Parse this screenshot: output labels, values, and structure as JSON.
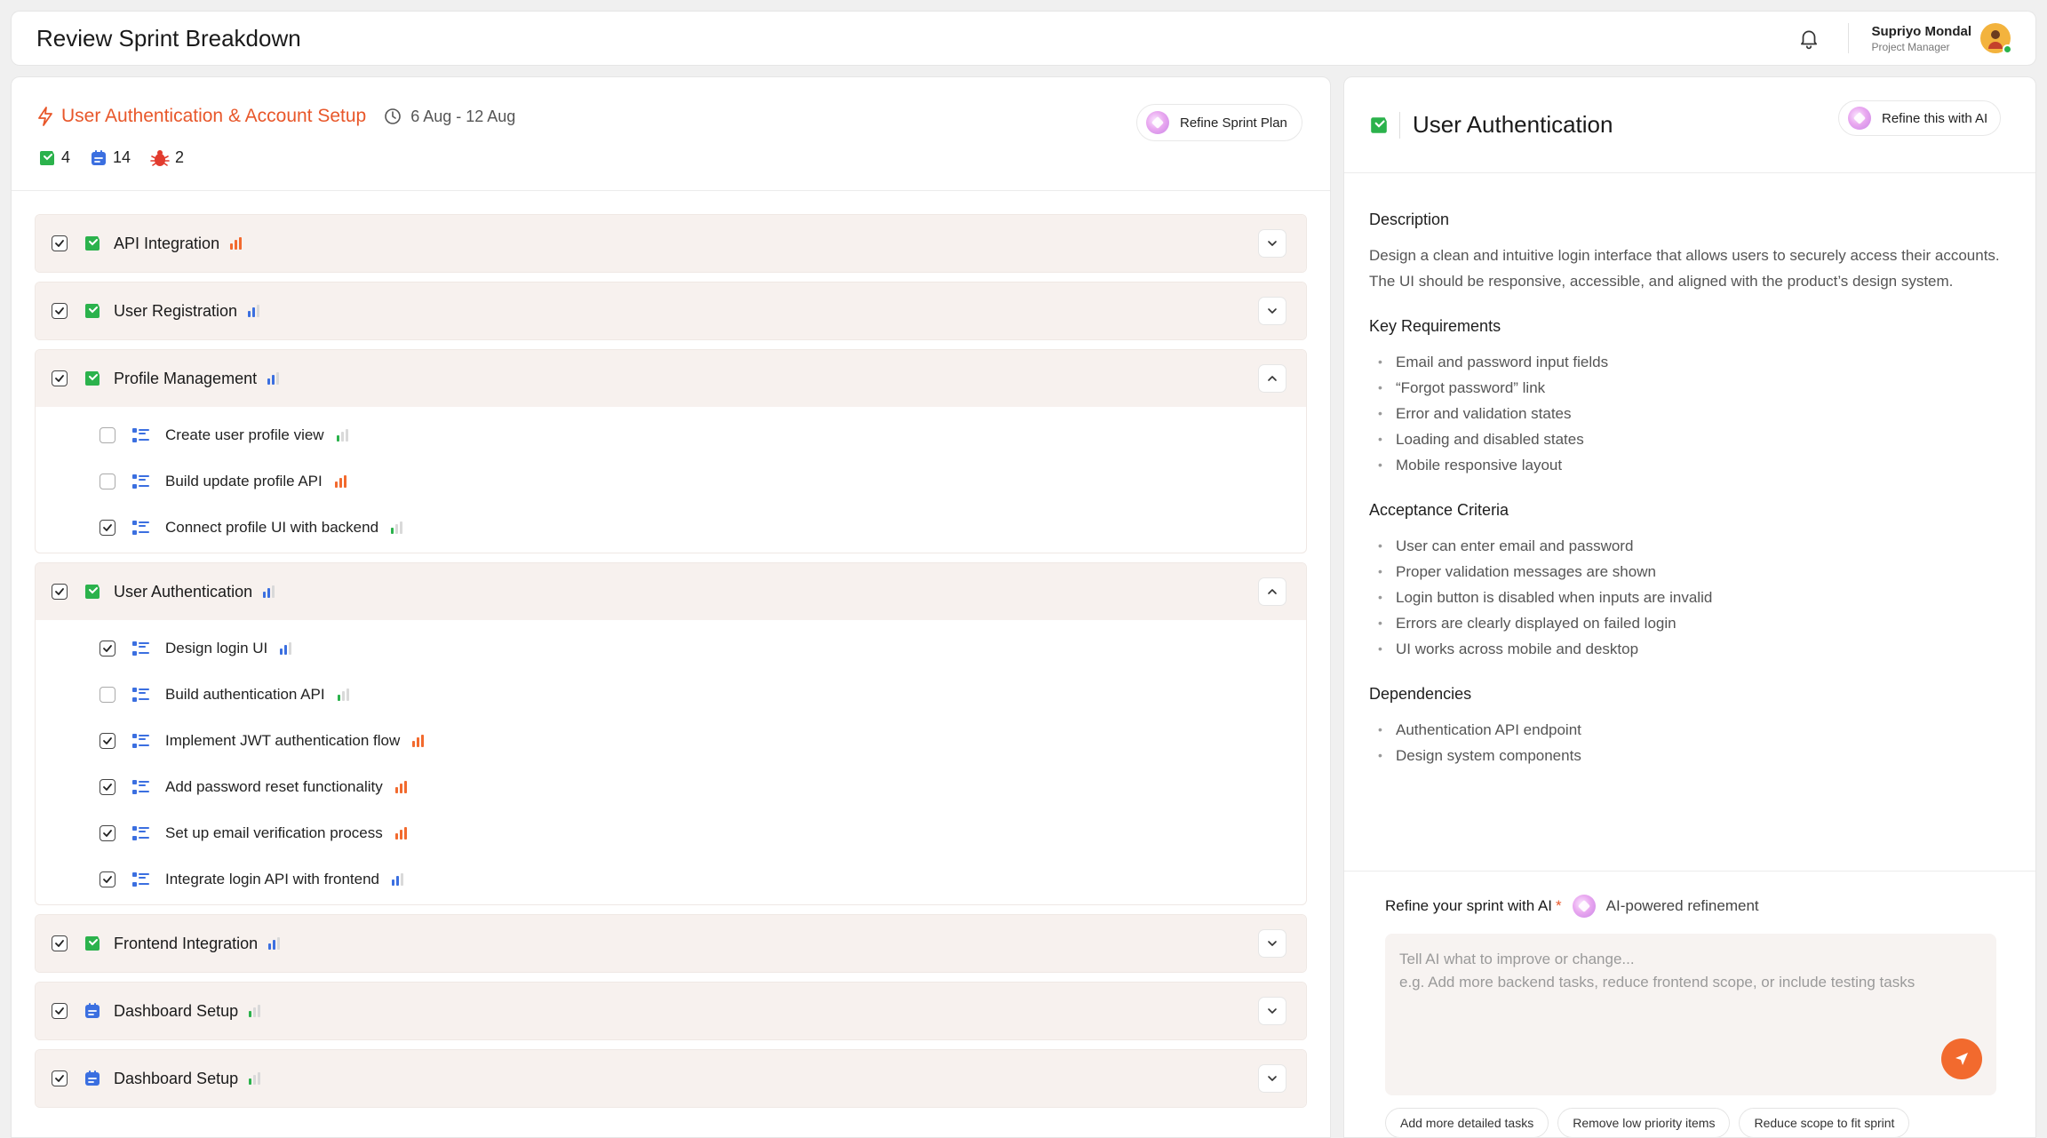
{
  "header": {
    "title": "Review Sprint Breakdown",
    "user_name": "Supriyo Mondal",
    "user_role": "Project Manager"
  },
  "sprint": {
    "title": "User Authentication & Account Setup",
    "date_range": "6 Aug - 12 Aug",
    "story_count": "4",
    "task_count": "14",
    "bug_count": "2",
    "refine_label": "Refine Sprint Plan"
  },
  "colors": {
    "accent": "#e8572a",
    "story_green": "#2bb24c",
    "task_blue": "#3b6fe0",
    "prio_high": "#f26a2e",
    "prio_medium": "#3b6fe0",
    "prio_low": "#2bb24c"
  },
  "stories": [
    {
      "label": "API Integration",
      "checked": true,
      "priority": "high",
      "expanded": false,
      "icon": "story-icon"
    },
    {
      "label": "User Registration",
      "checked": true,
      "priority": "medium",
      "expanded": false,
      "icon": "story-icon"
    },
    {
      "label": "Profile Management",
      "checked": true,
      "priority": "medium",
      "expanded": true,
      "icon": "story-icon",
      "tasks": [
        {
          "label": "Create user profile view",
          "checked": false,
          "priority": "low"
        },
        {
          "label": "Build update profile API",
          "checked": false,
          "priority": "high"
        },
        {
          "label": "Connect profile UI with backend",
          "checked": true,
          "priority": "low"
        }
      ]
    },
    {
      "label": "User Authentication",
      "checked": true,
      "priority": "medium",
      "expanded": true,
      "icon": "story-icon",
      "tasks": [
        {
          "label": "Design login UI",
          "checked": true,
          "priority": "medium"
        },
        {
          "label": "Build authentication API",
          "checked": false,
          "priority": "low"
        },
        {
          "label": "Implement JWT authentication flow",
          "checked": true,
          "priority": "high"
        },
        {
          "label": "Add password reset functionality",
          "checked": true,
          "priority": "high"
        },
        {
          "label": "Set up email verification process",
          "checked": true,
          "priority": "high"
        },
        {
          "label": "Integrate login API with frontend",
          "checked": true,
          "priority": "medium"
        }
      ]
    },
    {
      "label": "Frontend Integration",
      "checked": true,
      "priority": "medium",
      "expanded": false,
      "icon": "story-icon"
    },
    {
      "label": "Dashboard Setup",
      "checked": true,
      "priority": "low",
      "expanded": false,
      "icon": "task-icon"
    },
    {
      "label": "Dashboard Setup",
      "checked": true,
      "priority": "low",
      "expanded": false,
      "icon": "task-icon"
    }
  ],
  "detail": {
    "title": "User Authentication",
    "refine_label": "Refine this with AI",
    "description_title": "Description",
    "description_line1": "Design a clean and intuitive login interface that allows users to securely access their accounts.",
    "description_line2": "The UI should be responsive, accessible, and aligned with the product’s design system.",
    "requirements_title": "Key Requirements",
    "requirements": [
      "Email and password input fields",
      "“Forgot password” link",
      "Error and validation states",
      "Loading and disabled states",
      "Mobile responsive layout"
    ],
    "acceptance_title": "Acceptance Criteria",
    "acceptance": [
      "User can enter email and password",
      "Proper validation messages are shown",
      "Login button is disabled when inputs are invalid",
      "Errors are clearly displayed on failed login",
      "UI works across mobile and desktop"
    ],
    "dependencies_title": "Dependencies",
    "dependencies": [
      "Authentication API endpoint",
      "Design system components"
    ]
  },
  "refine": {
    "label": "Refine your sprint with AI",
    "required_mark": "*",
    "sublabel": "AI-powered refinement",
    "placeholder_line1": "Tell AI what to improve or change...",
    "placeholder_line2": "e.g. Add more backend tasks, reduce frontend scope, or include testing tasks",
    "chips": [
      "Add more detailed tasks",
      "Remove low priority items",
      "Reduce scope to fit sprint"
    ]
  }
}
